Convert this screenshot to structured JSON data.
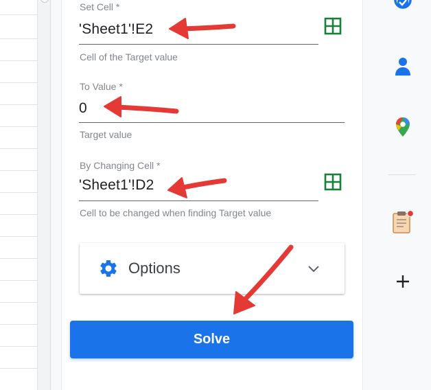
{
  "form": {
    "set_cell": {
      "label": "Set Cell *",
      "value": "'Sheet1'!E2",
      "help": "Cell of the Target value"
    },
    "to_value": {
      "label": "To Value *",
      "value": "0",
      "help": "Target value"
    },
    "by_changing": {
      "label": "By Changing Cell *",
      "value": "'Sheet1'!D2",
      "help": "Cell to be changed when finding Target value"
    }
  },
  "options": {
    "label": "Options",
    "icon": "gear-icon",
    "expand_icon": "chevron-down-icon"
  },
  "solve_button": {
    "label": "Solve"
  },
  "right_rail": {
    "icons": [
      "tasks-icon",
      "contacts-icon",
      "maps-icon",
      "clipboard-addon-icon",
      "plus-icon"
    ]
  },
  "colors": {
    "accent": "#1a73e8",
    "annotation_arrow": "#e53935",
    "range_picker": "#188038"
  }
}
